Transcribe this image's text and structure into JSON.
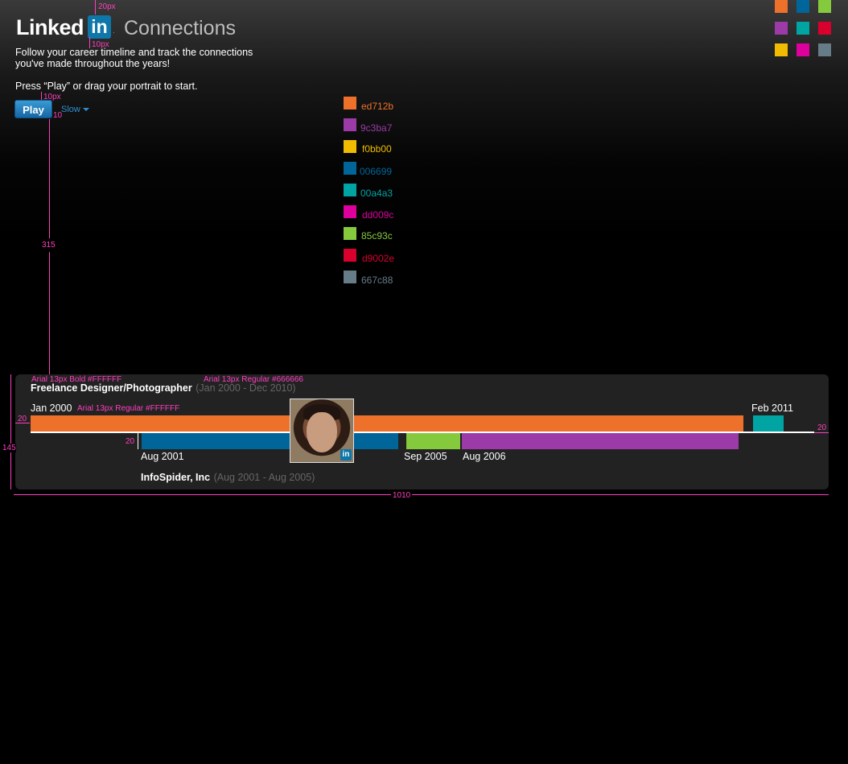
{
  "header": {
    "logo_text": "Linked",
    "logo_badge": "in",
    "logo_mark": ".",
    "app_title": "Connections",
    "tagline": "Follow your career timeline and track the connections you've made throughout the years!",
    "instruction": "Press “Play” or drag your portrait to start."
  },
  "controls": {
    "play_label": "Play",
    "speed_label": "Slow"
  },
  "palette_grid": [
    "#ed712b",
    "#006699",
    "#85c93c",
    "#9c3ba7",
    "#00a4a3",
    "#d9002e",
    "#f0bb00",
    "#dd009c",
    "#667c88"
  ],
  "swatches": [
    {
      "color": "#ed712b",
      "label": "ed712b"
    },
    {
      "color": "#9c3ba7",
      "label": "9c3ba7"
    },
    {
      "color": "#f0bb00",
      "label": "f0bb00"
    },
    {
      "color": "#006699",
      "label": "006699"
    },
    {
      "color": "#00a4a3",
      "label": "00a4a3"
    },
    {
      "color": "#dd009c",
      "label": "dd009c"
    },
    {
      "color": "#85c93c",
      "label": "85c93c"
    },
    {
      "color": "#d9002e",
      "label": "d9002e"
    },
    {
      "color": "#667c88",
      "label": "667c88"
    }
  ],
  "annotations": {
    "top_20": "20px",
    "logo_10_a": "10px",
    "play_10": "10px",
    "play_10b": "10",
    "vertical_315": "315",
    "title_font": "Arial 13px Bold #FFFFFF",
    "range_font": "Arial 13px Regular #666666",
    "date_font": "Arial 13px Regular #FFFFFF",
    "bar_20_left": "20",
    "bar_20_mid": "20",
    "bar_20_right": "20",
    "panel_height": "145",
    "panel_width": "1010"
  },
  "timeline": {
    "top_job": {
      "title": "Freelance Designer/Photographer",
      "range": "(Jan 2000 - Dec 2010)"
    },
    "bottom_job": {
      "title": "InfoSpider, Inc",
      "range": "(Aug 2001 - Aug 2005)"
    },
    "dates": {
      "jan2000": "Jan 2000",
      "feb2011": "Feb 2011",
      "aug2001": "Aug 2001",
      "sep2005": "Sep 2005",
      "aug2006": "Aug 2006"
    },
    "portrait_badge": "in"
  }
}
